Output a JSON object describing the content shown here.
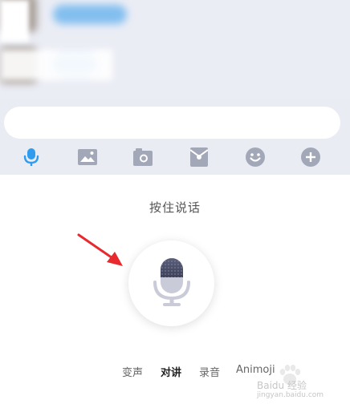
{
  "colors": {
    "accent": "#2f9cf0",
    "icon_gray": "#a3a8b8",
    "mic_dark": "#4b4f6a",
    "arrow_red": "#e8292e"
  },
  "input": {
    "value": "",
    "placeholder": ""
  },
  "toolbar": {
    "items": [
      {
        "icon": "microphone-icon",
        "active": true
      },
      {
        "icon": "image-icon",
        "active": false
      },
      {
        "icon": "camera-icon",
        "active": false
      },
      {
        "icon": "red-packet-icon",
        "active": false
      },
      {
        "icon": "emoji-icon",
        "active": false
      },
      {
        "icon": "plus-icon",
        "active": false
      }
    ]
  },
  "voice_panel": {
    "hint": "按住说话",
    "modes": [
      {
        "label": "变声",
        "active": false
      },
      {
        "label": "对讲",
        "active": true
      },
      {
        "label": "录音",
        "active": false
      },
      {
        "label": "Animoji",
        "active": false
      }
    ]
  },
  "watermark": {
    "brand": "Baidu 经验",
    "url": "jingyan.baidu.com"
  }
}
